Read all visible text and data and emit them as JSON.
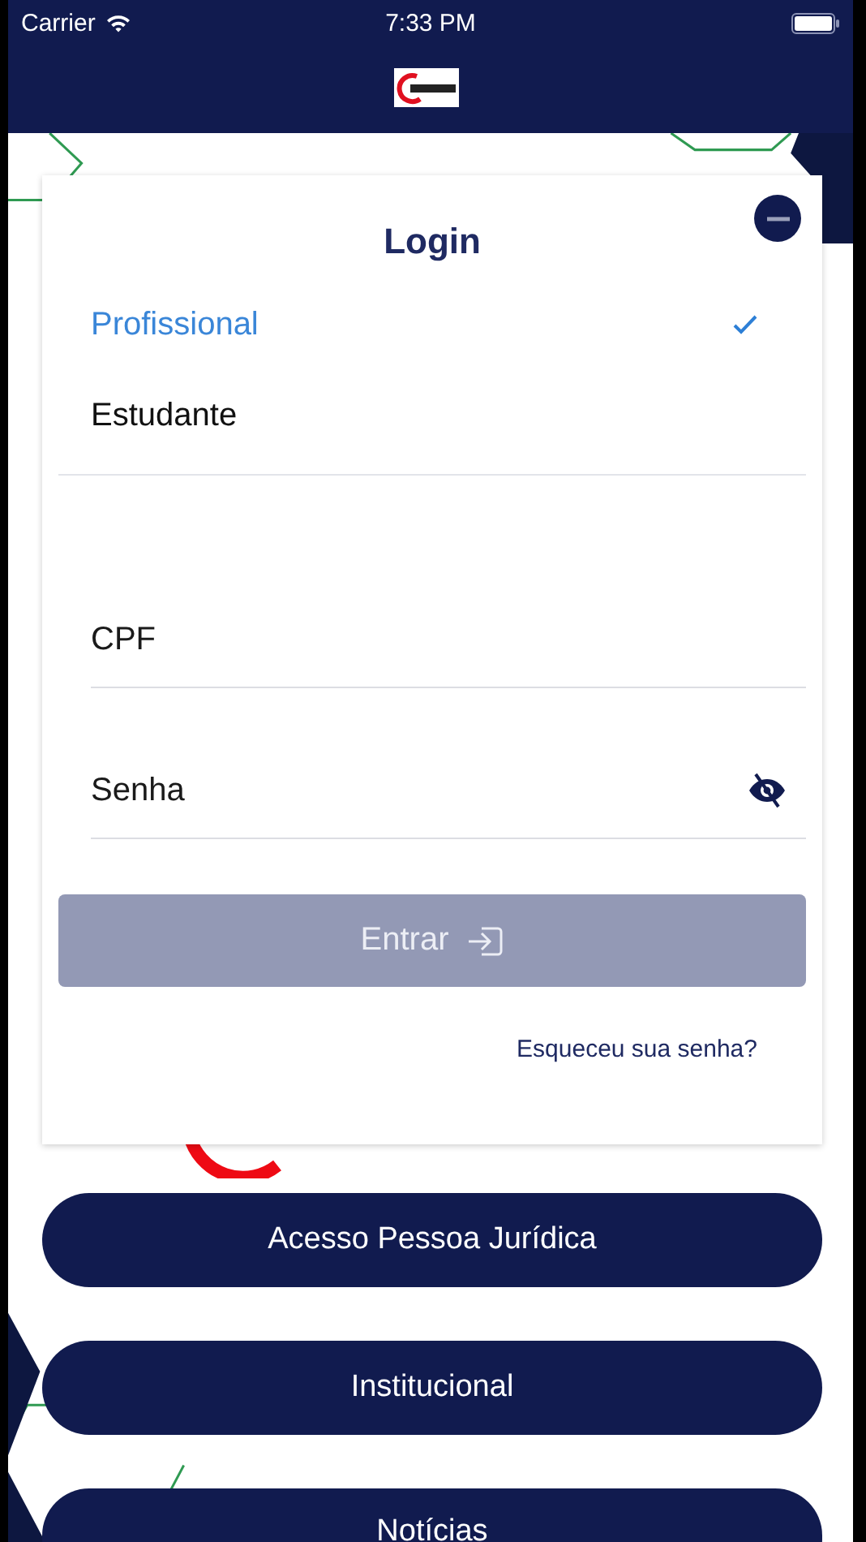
{
  "status_bar": {
    "carrier": "Carrier",
    "time": "7:33 PM"
  },
  "login": {
    "title": "Login",
    "user_types": [
      {
        "label": "Profissional",
        "selected": true
      },
      {
        "label": "Estudante",
        "selected": false
      }
    ],
    "fields": [
      {
        "placeholder": "CPF",
        "kind": "text"
      },
      {
        "placeholder": "Senha",
        "kind": "password"
      }
    ],
    "submit": {
      "label": "Entrar",
      "disabled": true
    },
    "forgot_link": "Esqueceu sua senha?"
  },
  "menu": [
    "Acesso Pessoa Jurídica",
    "Institucional",
    "Notícias"
  ]
}
